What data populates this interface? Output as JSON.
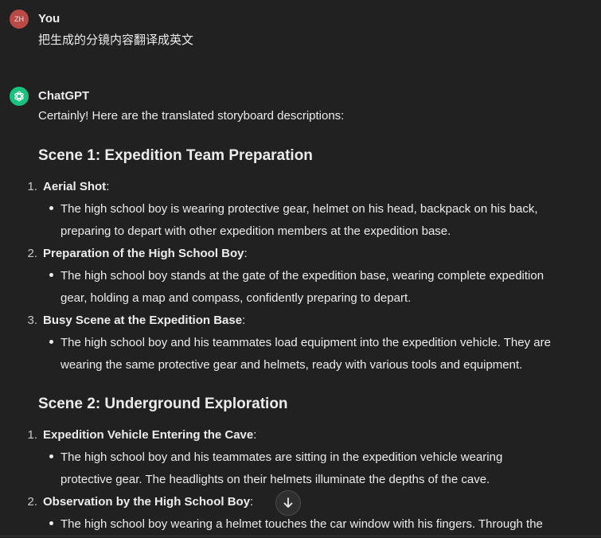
{
  "user": {
    "avatar_initials": "ZH",
    "name": "You",
    "message": "把生成的分镜内容翻译成英文"
  },
  "assistant": {
    "name": "ChatGPT",
    "intro": "Certainly! Here are the translated storyboard descriptions:",
    "scenes": [
      {
        "heading": "Scene 1: Expedition Team Preparation",
        "items": [
          {
            "number": "1.",
            "title": "Aerial Shot",
            "colon": ":",
            "desc_line1": "The high school boy is wearing protective gear, helmet on his head, backpack on his back,",
            "desc_line2": "preparing to depart with other expedition members at the expedition base."
          },
          {
            "number": "2.",
            "title": "Preparation of the High School Boy",
            "colon": ":",
            "desc_line1": "The high school boy stands at the gate of the expedition base, wearing complete expedition",
            "desc_line2": "gear, holding a map and compass, confidently preparing to depart."
          },
          {
            "number": "3.",
            "title": "Busy Scene at the Expedition Base",
            "colon": ":",
            "desc_line1": "The high school boy and his teammates load equipment into the expedition vehicle. They are",
            "desc_line2": "wearing the same protective gear and helmets, ready with various tools and equipment."
          }
        ]
      },
      {
        "heading": "Scene 2: Underground Exploration",
        "items": [
          {
            "number": "1.",
            "title": "Expedition Vehicle Entering the Cave",
            "colon": ":",
            "desc_line1": "The high school boy and his teammates are sitting in the expedition vehicle wearing",
            "desc_line2": "protective gear. The headlights on their helmets illuminate the depths of the cave."
          },
          {
            "number": "2.",
            "title": "Observation by the High School Boy",
            "colon": ":",
            "desc_line1": "The high school boy wearing a helmet touches the car window with his fingers. Through the"
          }
        ]
      }
    ]
  },
  "controls": {
    "scroll_down_icon": "arrow-down-icon"
  },
  "colors": {
    "background": "#212121",
    "text": "#ececec",
    "user_avatar": "#b94a45",
    "assistant_avatar": "#19c37d"
  }
}
